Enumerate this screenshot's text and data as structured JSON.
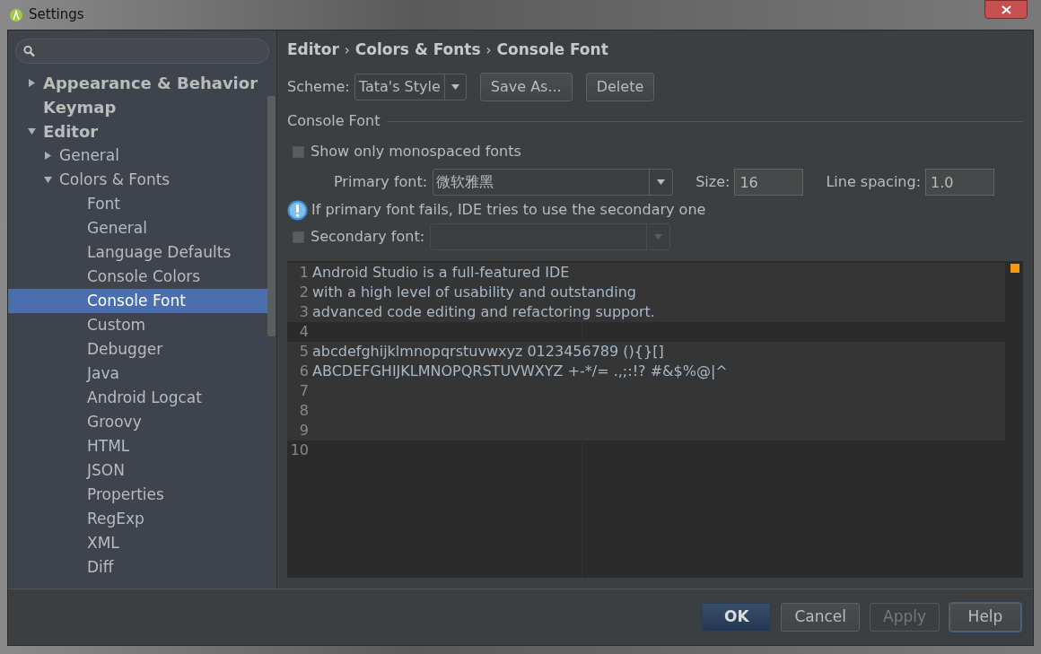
{
  "window": {
    "title": "Settings"
  },
  "sidebar": {
    "items": [
      {
        "label": "Appearance & Behavior",
        "expanded": false,
        "selected": false
      },
      {
        "label": "Keymap",
        "selected": false
      },
      {
        "label": "Editor",
        "expanded": true,
        "selected": false,
        "children": [
          {
            "label": "General",
            "expanded": false,
            "selected": false
          },
          {
            "label": "Colors & Fonts",
            "expanded": true,
            "selected": false,
            "children": [
              {
                "label": "Font",
                "selected": false
              },
              {
                "label": "General",
                "selected": false
              },
              {
                "label": "Language Defaults",
                "selected": false
              },
              {
                "label": "Console Colors",
                "selected": false
              },
              {
                "label": "Console Font",
                "selected": true
              },
              {
                "label": "Custom",
                "selected": false
              },
              {
                "label": "Debugger",
                "selected": false
              },
              {
                "label": "Java",
                "selected": false
              },
              {
                "label": "Android Logcat",
                "selected": false
              },
              {
                "label": "Groovy",
                "selected": false
              },
              {
                "label": "HTML",
                "selected": false
              },
              {
                "label": "JSON",
                "selected": false
              },
              {
                "label": "Properties",
                "selected": false
              },
              {
                "label": "RegExp",
                "selected": false
              },
              {
                "label": "XML",
                "selected": false
              },
              {
                "label": "Diff",
                "selected": false
              }
            ]
          }
        ]
      }
    ]
  },
  "breadcrumb": [
    "Editor",
    "Colors & Fonts",
    "Console Font"
  ],
  "breadcrumb_separator": "›",
  "scheme": {
    "label": "Scheme:",
    "value": "Tata's Style",
    "buttons": [
      "Save As...",
      "Delete"
    ]
  },
  "section_title": "Console Font",
  "monospaced": {
    "label": "Show only monospaced fonts",
    "checked": false
  },
  "primary_font": {
    "label": "Primary font:",
    "value": "微软雅黑"
  },
  "size": {
    "label": "Size:",
    "value": "16"
  },
  "line_spacing": {
    "label": "Line spacing:",
    "value": "1.0"
  },
  "info": "If primary font fails, IDE tries to use the secondary one",
  "secondary_font": {
    "label": "Secondary font:",
    "checked": false,
    "disabled": true
  },
  "preview": {
    "blocks": [
      {
        "kind": "band",
        "lines": [
          {
            "number": "1",
            "text": "Android Studio is a full-featured IDE"
          },
          {
            "number": "2",
            "text": "with a high level of usability and outstanding"
          },
          {
            "number": "3",
            "text": "advanced code editing and refactoring support."
          }
        ]
      },
      {
        "kind": "plain",
        "lines": [
          {
            "number": "4"
          }
        ]
      },
      {
        "kind": "band",
        "lines": [
          {
            "number": "5",
            "text": "abcdefghijklmnopqrstuvwxyz 0123456789 (){}[]"
          },
          {
            "number": "6",
            "text": "ABCDEFGHIJKLMNOPQRSTUVWXYZ +-*/= .,;:!? #&$%@|^"
          },
          {
            "number": "7"
          },
          {
            "number": "8"
          },
          {
            "number": "9"
          }
        ]
      },
      {
        "kind": "plain",
        "lines": [
          {
            "number": "10"
          }
        ]
      }
    ]
  },
  "buttons": [
    {
      "label": "OK",
      "default": true,
      "disabled": false,
      "focused": false
    },
    {
      "label": "Cancel",
      "default": false,
      "disabled": false,
      "focused": false
    },
    {
      "label": "Apply",
      "default": false,
      "disabled": true,
      "focused": false
    },
    {
      "label": "Help",
      "default": false,
      "disabled": false,
      "focused": true
    }
  ]
}
